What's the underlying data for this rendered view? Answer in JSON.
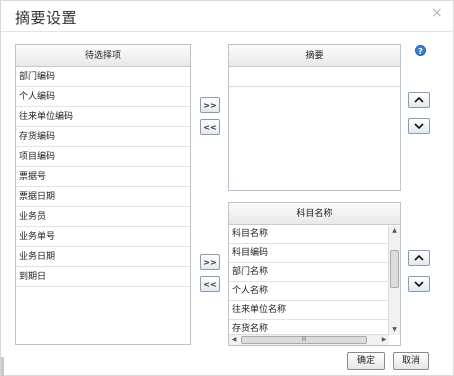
{
  "dialog": {
    "title": "摘要设置",
    "close_glyph": "×"
  },
  "source_panel": {
    "header": "待选择项",
    "items": [
      "部门编码",
      "个人编码",
      "往来单位编码",
      "存货编码",
      "项目编码",
      "票据号",
      "票据日期",
      "业务员",
      "业务单号",
      "业务日期",
      "到期日"
    ]
  },
  "summary_panel": {
    "header": "摘要"
  },
  "subject_panel": {
    "header": "科目名称",
    "items": [
      "科目名称",
      "科目编码",
      "部门名称",
      "个人名称",
      "往来单位名称",
      "存货名称"
    ],
    "hscroll_grip": "III"
  },
  "buttons": {
    "add": ">>",
    "remove": "<<",
    "add2": ">>",
    "remove2": "<<",
    "confirm": "确定",
    "cancel": "取消",
    "help": "?"
  },
  "icons": {
    "move_up": "chevron-up-icon",
    "move_down": "chevron-down-icon",
    "help": "help-icon"
  },
  "colors": {
    "panel_border": "#b7c4d3",
    "help_blue": "#3a7fd6"
  }
}
